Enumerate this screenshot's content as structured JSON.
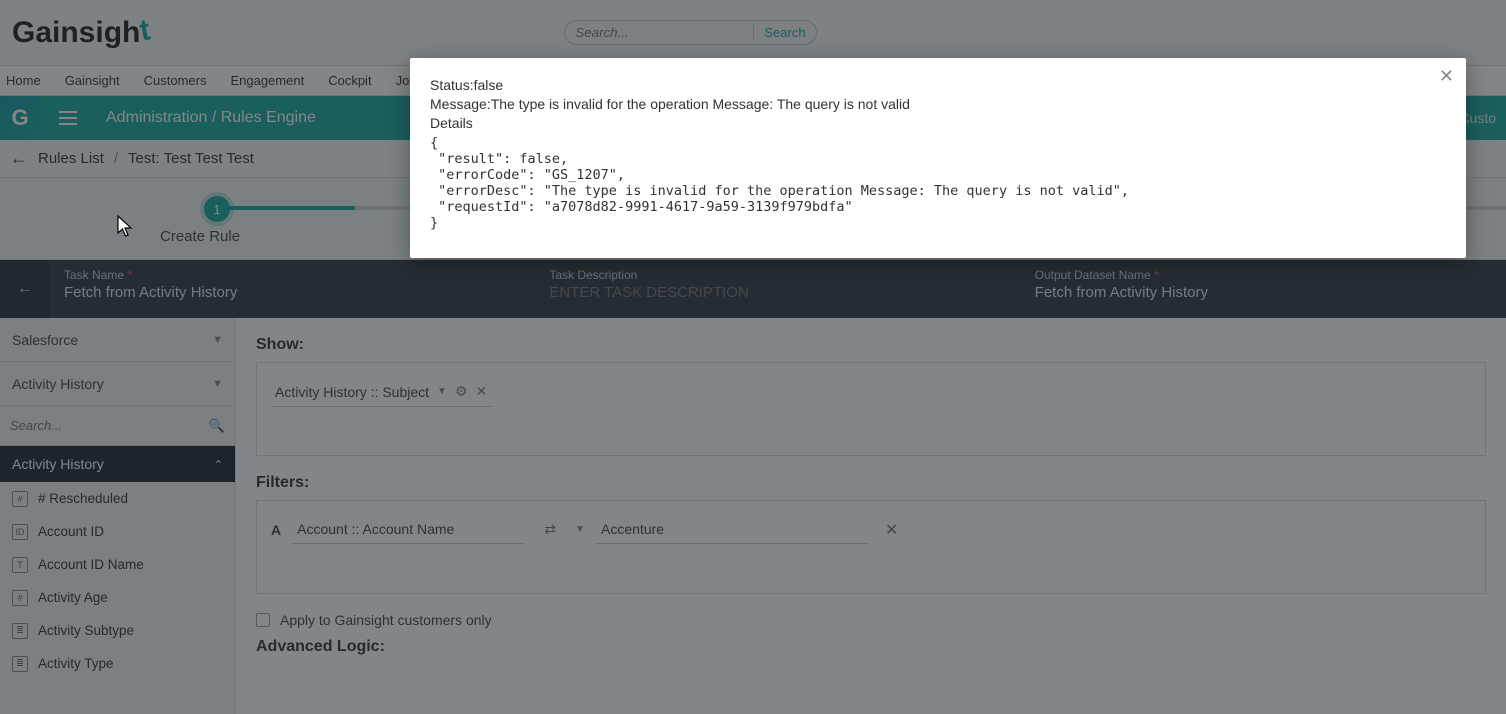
{
  "brand": {
    "name": "Gainsight"
  },
  "search": {
    "placeholder": "Search...",
    "button": "Search"
  },
  "nav": {
    "items": [
      "Home",
      "Gainsight",
      "Customers",
      "Engagement",
      "Cockpit",
      "Journey"
    ]
  },
  "adminbar": {
    "title": "Administration / Rules Engine",
    "right": "Custo"
  },
  "crumbs": {
    "back_icon": "←",
    "items": [
      "Rules List",
      "Test: Test Test Test"
    ],
    "sep": "/"
  },
  "stepper": {
    "step_number": "1",
    "step_label": "Create Rule"
  },
  "task": {
    "back_icon": "←",
    "name_label": "Task Name",
    "name_value": "Fetch from Activity History",
    "desc_label": "Task Description",
    "desc_placeholder": "ENTER TASK DESCRIPTION",
    "output_label": "Output Dataset Name",
    "output_value": "Fetch from Activity History"
  },
  "left": {
    "source_select": "Salesforce",
    "object_select": "Activity History",
    "field_search_placeholder": "Search...",
    "group_header": "Activity History",
    "fields": [
      {
        "icon": "#",
        "label": "# Rescheduled"
      },
      {
        "icon": "ID",
        "label": "Account ID"
      },
      {
        "icon": "T",
        "label": "Account ID Name"
      },
      {
        "icon": "#",
        "label": "Activity Age"
      },
      {
        "icon": "≣",
        "label": "Activity Subtype"
      },
      {
        "icon": "≣",
        "label": "Activity Type"
      }
    ]
  },
  "right": {
    "show_label": "Show:",
    "show_chip": "Activity History :: Subject",
    "filters_label": "Filters:",
    "filter_letter": "A",
    "filter_field": "Account :: Account Name",
    "filter_value": "Accenture",
    "apply_chk": "Apply to Gainsight customers only",
    "advanced_label": "Advanced Logic:"
  },
  "modal": {
    "status_line": "Status:false",
    "message_line": "Message:The type is invalid for the operation Message: The query is not valid",
    "details_line": "Details",
    "json_body": "{\n \"result\": false,\n \"errorCode\": \"GS_1207\",\n \"errorDesc\": \"The type is invalid for the operation Message: The query is not valid\",\n \"requestId\": \"a7078d82-9991-4617-9a59-3139f979bdfa\"\n}"
  },
  "chart_data": null
}
